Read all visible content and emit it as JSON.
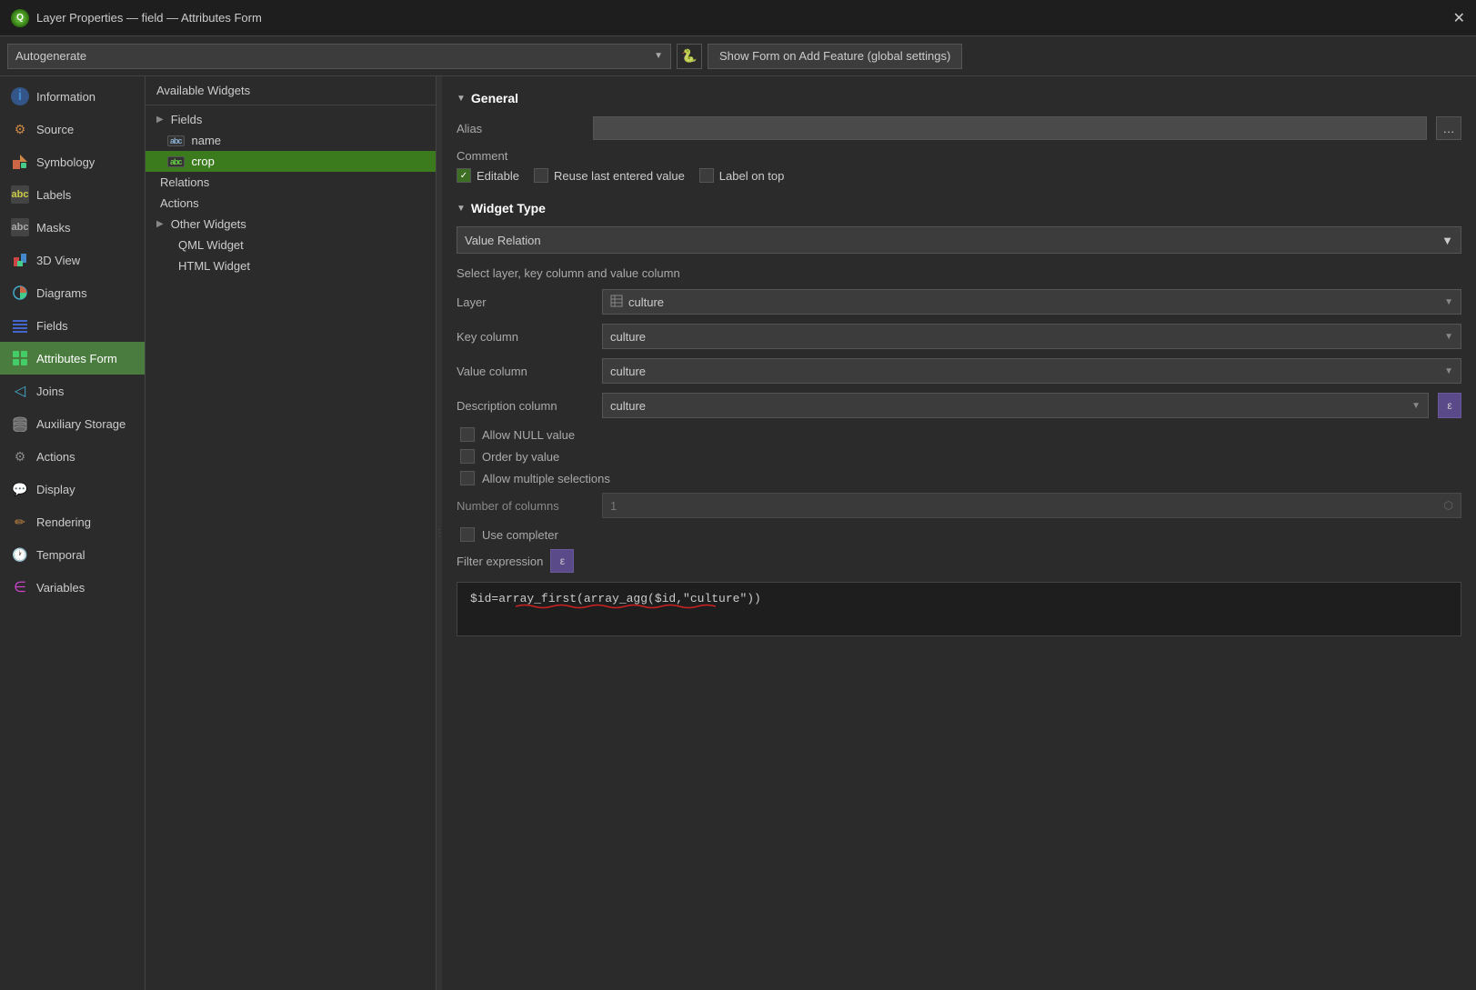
{
  "window": {
    "title": "Layer Properties — field — Attributes Form",
    "close_label": "✕"
  },
  "toolbar": {
    "dropdown_value": "Autogenerate",
    "dropdown_arrow": "▼",
    "python_icon": "🐍",
    "show_form_button": "Show Form on Add Feature (global settings)"
  },
  "sidebar": {
    "items": [
      {
        "id": "information",
        "label": "Information",
        "icon": "ℹ",
        "icon_color": "#4488cc",
        "active": false
      },
      {
        "id": "source",
        "label": "Source",
        "icon": "⚙",
        "icon_color": "#cc8844",
        "active": false
      },
      {
        "id": "symbology",
        "label": "Symbology",
        "icon": "🎨",
        "icon_color": "#cc6644",
        "active": false
      },
      {
        "id": "labels",
        "label": "Labels",
        "icon": "abc",
        "icon_color": "#cccc44",
        "active": false
      },
      {
        "id": "masks",
        "label": "Masks",
        "icon": "abc",
        "icon_color": "#aaaaaa",
        "active": false
      },
      {
        "id": "3dview",
        "label": "3D View",
        "icon": "◆",
        "icon_color": "#cc4444",
        "active": false
      },
      {
        "id": "diagrams",
        "label": "Diagrams",
        "icon": "◑",
        "icon_color": "#44aacc",
        "active": false
      },
      {
        "id": "fields",
        "label": "Fields",
        "icon": "≡",
        "icon_color": "#4466cc",
        "active": false
      },
      {
        "id": "attributes-form",
        "label": "Attributes Form",
        "icon": "▦",
        "icon_color": "#44cc66",
        "active": true
      },
      {
        "id": "joins",
        "label": "Joins",
        "icon": "◁",
        "icon_color": "#44aacc",
        "active": false
      },
      {
        "id": "auxiliary-storage",
        "label": "Auxiliary Storage",
        "icon": "🗄",
        "icon_color": "#aaaaaa",
        "active": false
      },
      {
        "id": "actions",
        "label": "Actions",
        "icon": "⚙",
        "icon_color": "#888888",
        "active": false
      },
      {
        "id": "display",
        "label": "Display",
        "icon": "💬",
        "icon_color": "#cccc44",
        "active": false
      },
      {
        "id": "rendering",
        "label": "Rendering",
        "icon": "✏",
        "icon_color": "#cc8844",
        "active": false
      },
      {
        "id": "temporal",
        "label": "Temporal",
        "icon": "🕐",
        "icon_color": "#aaaaaa",
        "active": false
      },
      {
        "id": "variables",
        "label": "Variables",
        "icon": "∈",
        "icon_color": "#cc44cc",
        "active": false
      }
    ]
  },
  "widget_panel": {
    "header": "Available Widgets",
    "tree": [
      {
        "id": "fields-group",
        "label": "Fields",
        "indent": 0,
        "has_arrow": true,
        "type": "group"
      },
      {
        "id": "field-name",
        "label": "name",
        "indent": 1,
        "type": "field",
        "icon": "abc"
      },
      {
        "id": "field-crop",
        "label": "crop",
        "indent": 1,
        "type": "field",
        "icon": "abc",
        "active": true
      },
      {
        "id": "relations",
        "label": "Relations",
        "indent": 0,
        "type": "item"
      },
      {
        "id": "actions",
        "label": "Actions",
        "indent": 0,
        "type": "item"
      },
      {
        "id": "other-widgets",
        "label": "Other Widgets",
        "indent": 0,
        "has_arrow": true,
        "type": "group"
      },
      {
        "id": "qml-widget",
        "label": "QML Widget",
        "indent": 1,
        "type": "item"
      },
      {
        "id": "html-widget",
        "label": "HTML Widget",
        "indent": 1,
        "type": "item"
      }
    ]
  },
  "general_section": {
    "title": "General",
    "alias_label": "Alias",
    "alias_value": "",
    "alias_placeholder": "",
    "alias_btn": "…",
    "comment_label": "Comment",
    "editable_label": "Editable",
    "editable_checked": true,
    "reuse_label": "Reuse last entered value",
    "reuse_checked": false,
    "label_on_top_label": "Label on top",
    "label_on_top_checked": false
  },
  "widget_type_section": {
    "title": "Widget Type",
    "selected": "Value Relation",
    "dropdown_arrow": "▼",
    "select_info": "Select layer, key column and value column",
    "layer_label": "Layer",
    "layer_value": "culture",
    "layer_icon": "▦",
    "key_column_label": "Key column",
    "key_column_value": "culture",
    "value_column_label": "Value column",
    "value_column_value": "culture",
    "description_column_label": "Description column",
    "description_column_value": "culture",
    "allow_null_label": "Allow NULL value",
    "allow_null_checked": false,
    "order_by_label": "Order by value",
    "order_by_checked": false,
    "allow_multiple_label": "Allow multiple selections",
    "allow_multiple_checked": false,
    "num_columns_label": "Number of columns",
    "num_columns_value": "1",
    "use_completer_label": "Use completer",
    "use_completer_checked": false,
    "filter_expr_label": "Filter expression",
    "filter_expr_btn": "ε",
    "code_expression": "$id=array_first(array_agg($id,\"culture\"))"
  },
  "resizer_dots": "⋮"
}
